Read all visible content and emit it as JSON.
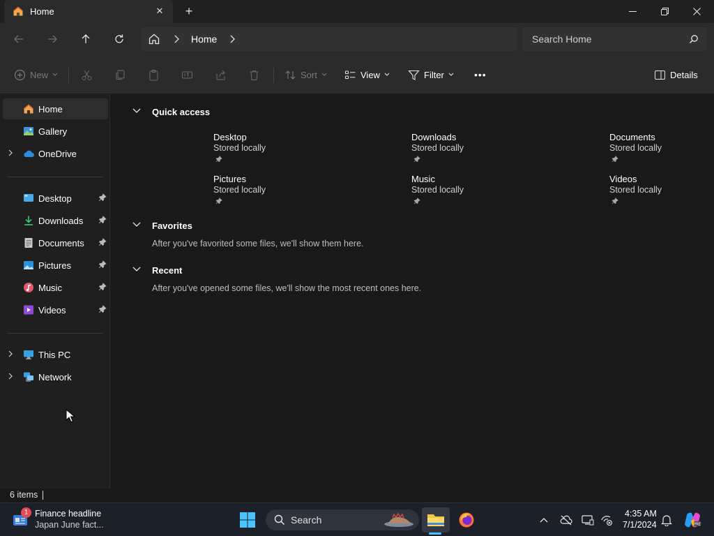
{
  "window": {
    "tab_title": "Home",
    "new_tab_glyph": "+",
    "close_tab_glyph": "✕"
  },
  "address": {
    "crumbs": [
      "Home"
    ],
    "search_placeholder": "Search Home"
  },
  "commands": {
    "new": "New",
    "sort": "Sort",
    "view": "View",
    "filter": "Filter",
    "more": "•••",
    "details": "Details"
  },
  "sidebar": {
    "top": [
      {
        "label": "Home",
        "icon": "home-icon",
        "selected": true
      },
      {
        "label": "Gallery",
        "icon": "gallery-icon"
      },
      {
        "label": "OneDrive",
        "icon": "cloud-icon",
        "expandable": true
      }
    ],
    "pinned": [
      {
        "label": "Desktop",
        "icon": "desktop-folder-icon"
      },
      {
        "label": "Downloads",
        "icon": "downloads-icon"
      },
      {
        "label": "Documents",
        "icon": "documents-icon"
      },
      {
        "label": "Pictures",
        "icon": "pictures-icon"
      },
      {
        "label": "Music",
        "icon": "music-icon"
      },
      {
        "label": "Videos",
        "icon": "videos-icon"
      }
    ],
    "bottom": [
      {
        "label": "This PC",
        "icon": "pc-icon",
        "expandable": true
      },
      {
        "label": "Network",
        "icon": "network-icon",
        "expandable": true
      }
    ]
  },
  "main": {
    "quick_access": {
      "title": "Quick access",
      "items": [
        {
          "name": "Desktop",
          "sub": "Stored locally"
        },
        {
          "name": "Downloads",
          "sub": "Stored locally"
        },
        {
          "name": "Documents",
          "sub": "Stored locally"
        },
        {
          "name": "Pictures",
          "sub": "Stored locally"
        },
        {
          "name": "Music",
          "sub": "Stored locally"
        },
        {
          "name": "Videos",
          "sub": "Stored locally"
        }
      ]
    },
    "favorites": {
      "title": "Favorites",
      "empty": "After you've favorited some files, we'll show them here."
    },
    "recent": {
      "title": "Recent",
      "empty": "After you've opened some files, we'll show the most recent ones here."
    }
  },
  "status": {
    "count": "6 items"
  },
  "taskbar": {
    "news_badge": "1",
    "news_title": "Finance headline",
    "news_sub": "Japan June fact...",
    "search": "Search",
    "time": "4:35 AM",
    "date": "7/1/2024"
  },
  "colors": {
    "accent": "#4cc2ff",
    "folder_yellow": "#f5c342",
    "badge_red": "#e74856"
  }
}
